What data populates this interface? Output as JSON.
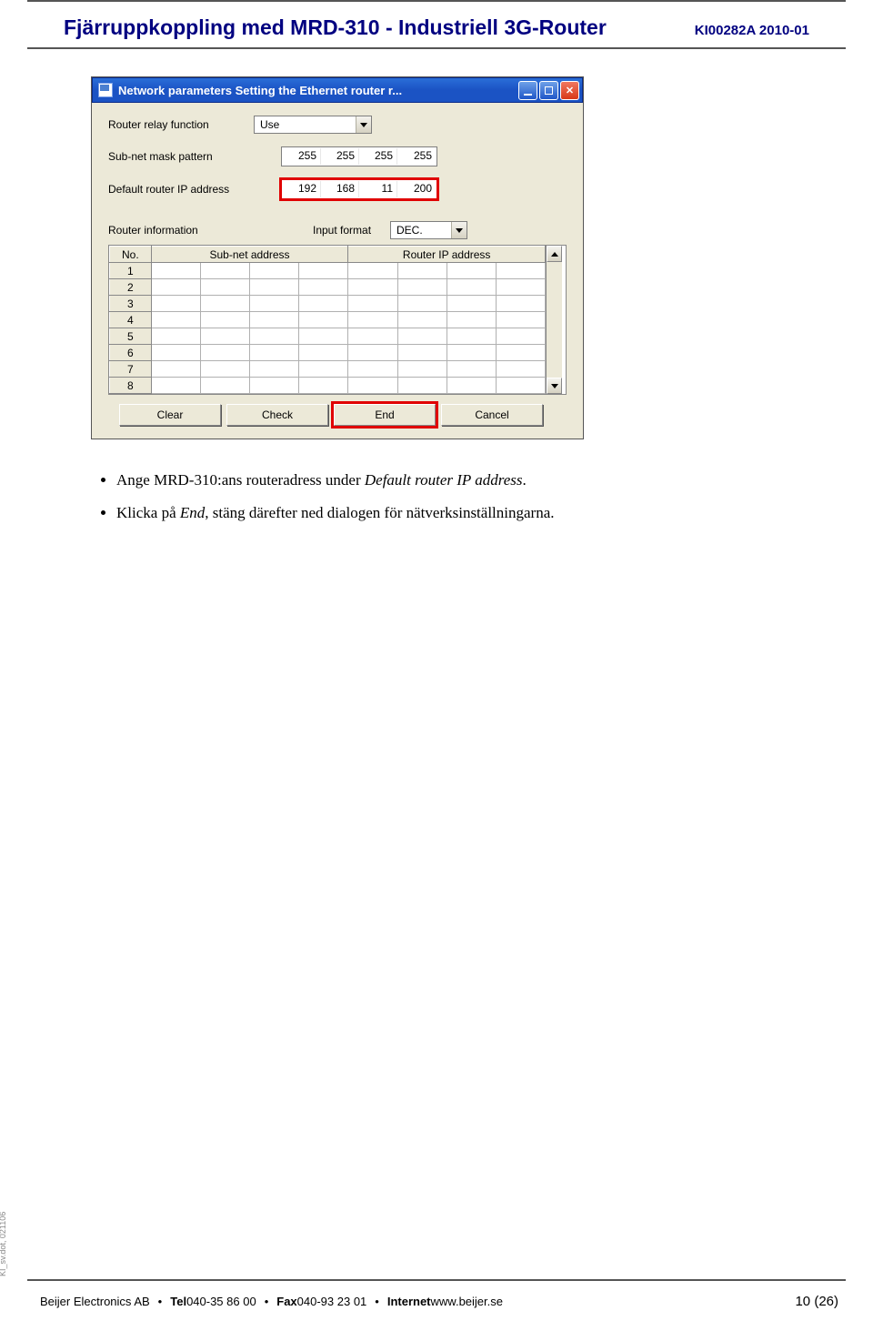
{
  "header": {
    "title": "Fjärruppkoppling med MRD-310 - Industriell 3G-Router",
    "code": "KI00282A 2010-01"
  },
  "dialog": {
    "title": "Network parameters  Setting the Ethernet router r...",
    "router_relay_label": "Router relay function",
    "router_relay_value": "Use",
    "subnet_mask_label": "Sub-net mask pattern",
    "subnet_mask": [
      "255",
      "255",
      "255",
      "255"
    ],
    "default_router_label": "Default router IP address",
    "default_router": [
      "192",
      "168",
      "11",
      "200"
    ],
    "router_info_label": "Router information",
    "input_format_label": "Input format",
    "input_format_value": "DEC.",
    "table": {
      "col_no": "No.",
      "col_subnet": "Sub-net address",
      "col_router": "Router IP address",
      "rows": [
        "1",
        "2",
        "3",
        "4",
        "5",
        "6",
        "7",
        "8"
      ]
    },
    "buttons": {
      "clear": "Clear",
      "check": "Check",
      "end": "End",
      "cancel": "Cancel"
    }
  },
  "bullets": {
    "b1_pre": "Ange MRD-310:ans routeradress under ",
    "b1_em": "Default router IP address",
    "b1_post": ".",
    "b2_pre": "Klicka på ",
    "b2_em": "End",
    "b2_post": ", stäng därefter ned dialogen för nätverksinställningarna."
  },
  "footer": {
    "company": "Beijer Electronics AB",
    "tel_label": "Tel",
    "tel": " 040-35 86 00",
    "fax_label": "Fax",
    "fax": " 040-93 23 01",
    "internet_label": "Internet",
    "internet": " www.beijer.se",
    "page": "10 (26)"
  },
  "sidenote": "KI_sv.dot, 021106"
}
